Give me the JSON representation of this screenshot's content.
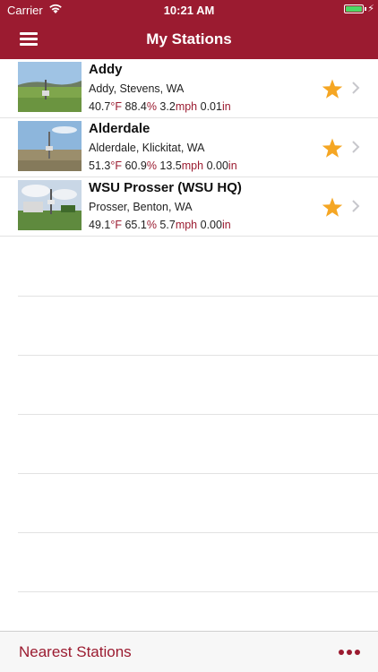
{
  "status_bar": {
    "carrier": "Carrier",
    "time": "10:21 AM"
  },
  "nav": {
    "title": "My Stations",
    "menu_icon": "hamburger-menu-icon"
  },
  "stations": [
    {
      "name": "Addy",
      "location": "Addy, Stevens, WA",
      "temp": "40.7",
      "temp_unit": "°F",
      "humidity": "88.4",
      "humidity_unit": "%",
      "wind": "3.2",
      "wind_unit": "mph",
      "precip": "0.01",
      "precip_unit": "in",
      "favorite": true
    },
    {
      "name": "Alderdale",
      "location": "Alderdale, Klickitat, WA",
      "temp": "51.3",
      "temp_unit": "°F",
      "humidity": "60.9",
      "humidity_unit": "%",
      "wind": "13.5",
      "wind_unit": "mph",
      "precip": "0.00",
      "precip_unit": "in",
      "favorite": true
    },
    {
      "name": "WSU Prosser (WSU HQ)",
      "location": "Prosser, Benton, WA",
      "temp": "49.1",
      "temp_unit": "°F",
      "humidity": "65.1",
      "humidity_unit": "%",
      "wind": "5.7",
      "wind_unit": "mph",
      "precip": "0.00",
      "precip_unit": "in",
      "favorite": true
    }
  ],
  "footer": {
    "nearest_label": "Nearest Stations",
    "more_icon": "ellipsis-icon"
  },
  "colors": {
    "brand": "#9b1b30",
    "star": "#f5a623",
    "battery": "#4cd964"
  }
}
